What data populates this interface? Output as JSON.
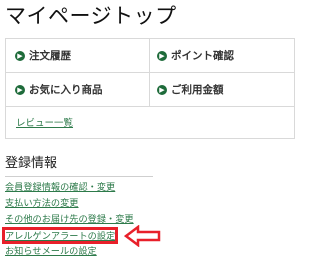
{
  "page": {
    "title": "マイページトップ"
  },
  "menu": {
    "order_history": "注文履歴",
    "point_check": "ポイント確認",
    "favorites": "お気に入り商品",
    "usage_amount": "ご利用金額",
    "review_list": "レビュー一覧"
  },
  "registration": {
    "title": "登録情報",
    "links": [
      "会員登録情報の確認・変更",
      "支払い方法の変更",
      "その他のお届け先の登録・変更",
      "アレルゲンアラートの設定",
      "お知らせメールの設定"
    ]
  },
  "colors": {
    "link": "#2d7a4a",
    "icon_bg": "#1e6b3a",
    "highlight": "#e8202a"
  }
}
